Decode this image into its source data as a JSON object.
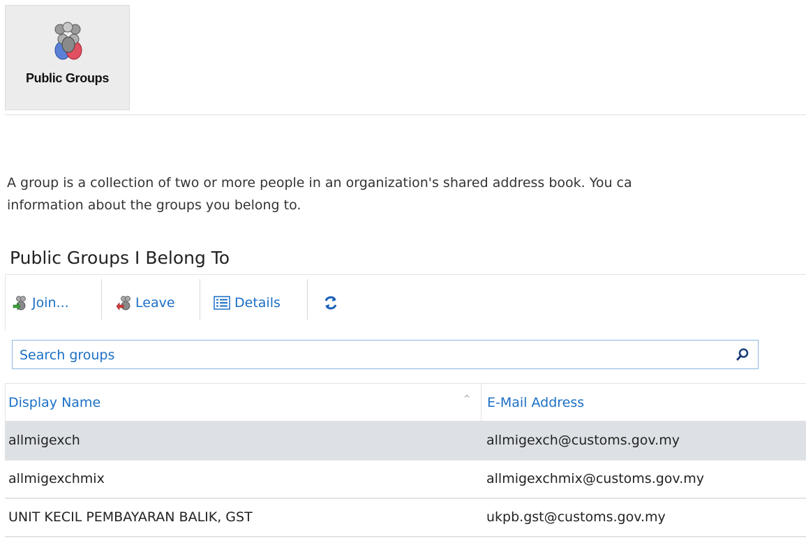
{
  "tile": {
    "label": "Public Groups",
    "icon": "group-people-icon"
  },
  "description": {
    "line1": "A group is a collection of two or more people in an organization's shared address book. You ca",
    "line2": "information about the groups you belong to."
  },
  "section_title": "Public Groups I Belong To",
  "toolbar": {
    "join_label": "Join...",
    "leave_label": "Leave",
    "details_label": "Details",
    "refresh_icon": "refresh-icon"
  },
  "search": {
    "placeholder": "Search groups",
    "value": ""
  },
  "table": {
    "columns": [
      "Display Name",
      "E-Mail Address"
    ],
    "rows": [
      {
        "name": "allmigexch",
        "email": "allmigexch@customs.gov.my",
        "selected": true
      },
      {
        "name": "allmigexchmix",
        "email": "allmigexchmix@customs.gov.my",
        "selected": false
      },
      {
        "name": "UNIT KECIL PEMBAYARAN BALIK, GST",
        "email": "ukpb.gst@customs.gov.my",
        "selected": false
      }
    ]
  },
  "colors": {
    "accent": "#1a6fc6",
    "selected_row": "#dde1e6",
    "tile_bg": "#ececec"
  }
}
